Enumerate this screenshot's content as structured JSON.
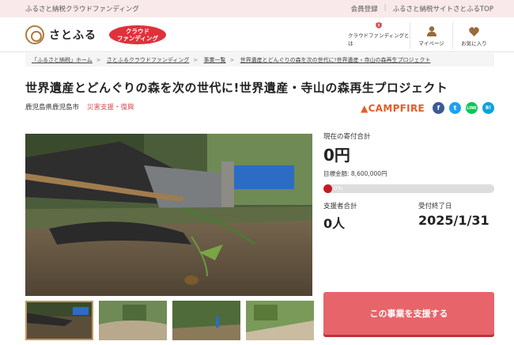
{
  "topbar": {
    "tagline": "ふるさと納税クラウドファンディング",
    "links": [
      "会員登録",
      "ふるさと納税サイトさとふるTOP"
    ]
  },
  "header": {
    "logo_text": "さとふる",
    "badge_line1": "クラウド",
    "badge_line2": "ファンディング",
    "nav": [
      {
        "label": "クラウドファンディングとは",
        "icon": "shield-icon"
      },
      {
        "label": "マイページ",
        "icon": "user-icon"
      },
      {
        "label": "お気に入り",
        "icon": "heart-icon"
      }
    ]
  },
  "breadcrumb": [
    "「ふるさと納税」ホーム",
    "さとふるクラウドファンディング",
    "事業一覧",
    "世界遺産とどんぐりの森を次の世代に!世界遺産・寺山の森再生プロジェクト"
  ],
  "project": {
    "title": "世界遺産とどんぐりの森を次の世代に!世界遺産・寺山の森再生プロジェクト",
    "location": "鹿児島県鹿児島市",
    "tag": "災害支援・復興",
    "platform": "CAMPFIRE",
    "share_buttons": [
      "f",
      "t",
      "LINE",
      "B!"
    ]
  },
  "stats": {
    "current_label": "現在の寄付合計",
    "current_amount": "0円",
    "target_label": "目標金額: 8,600,000円",
    "progress_text": "0%",
    "progress_value": 0,
    "supporters_label": "支援者合計",
    "supporters": "0人",
    "deadline_label": "受付終了日",
    "deadline": "2025/1/31"
  },
  "cta": {
    "label": "この事業を支援する"
  },
  "colors": {
    "accent": "#e8646b",
    "brand_red": "#e0313b",
    "topbar_bg": "#f9e9ea",
    "progress_fill": "#c21c24"
  }
}
